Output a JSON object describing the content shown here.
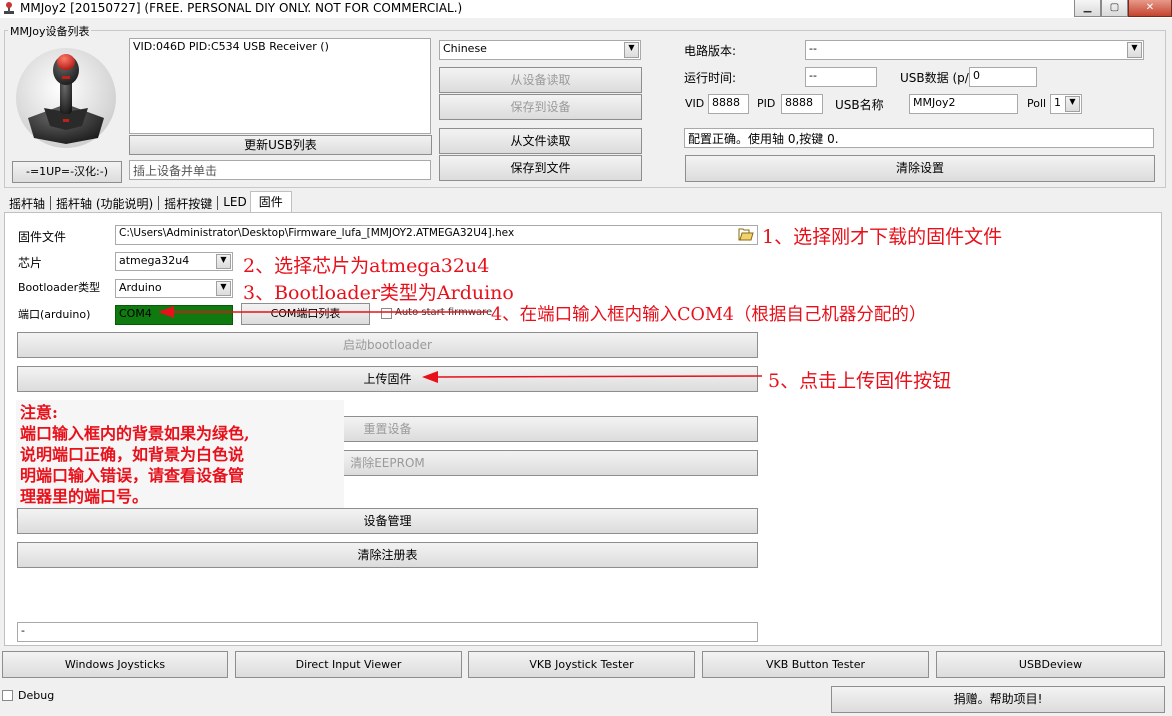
{
  "window": {
    "title": "MMJoy2 [20150727] (FREE. PERSONAL DIY ONLY. NOT FOR COMMERCIAL.)"
  },
  "device_group": {
    "label": "MMJoy设备列表",
    "device_list": [
      "VID:046D PID:C534 USB Receiver ()"
    ],
    "refresh_usb_label": "更新USB列表",
    "about_label": "-=1UP=-汉化:-)",
    "hint_text": "插上设备并单击"
  },
  "language": {
    "selected": "Chinese"
  },
  "actions": {
    "read_device": "从设备读取",
    "save_device": "保存到设备",
    "read_file": "从文件读取",
    "save_file": "保存到文件"
  },
  "board": {
    "version_label": "电路版本:",
    "version_value": "--",
    "uptime_label": "运行时间:",
    "uptime_value": "--",
    "usb_data_label": "USB数据 (p/s",
    "usb_data_value": "0",
    "vid_label": "VID",
    "vid_value": "8888",
    "pid_label": "PID",
    "pid_value": "8888",
    "usb_name_label": "USB名称",
    "usb_name_value": "MMJoy2",
    "poll_label": "Poll",
    "poll_value": "1",
    "status_text": "配置正确。使用轴 0,按键 0.",
    "clear_settings": "清除设置"
  },
  "tabs": [
    "摇杆轴",
    "摇杆轴 (功能说明)",
    "摇杆按键",
    "LED",
    "固件"
  ],
  "firmware": {
    "file_label": "固件文件",
    "file_path": "C:\\Users\\Administrator\\Desktop\\Firmware_lufa_[MMJOY2.ATMEGA32U4].hex",
    "chip_label": "芯片",
    "chip_value": "atmega32u4",
    "bootloader_label": "Bootloader类型",
    "bootloader_value": "Arduino",
    "port_label": "端口(arduino)",
    "port_value": "COM4",
    "com_list_button": "COM端口列表",
    "auto_start_label": "Auto start firmware",
    "start_bootloader": "启动bootloader",
    "upload_firmware": "上传固件",
    "reset_device": "重置设备",
    "clear_eeprom": "清除EEPROM",
    "device_manager": "设备管理",
    "clear_registry": "清除注册表",
    "log_text": "-"
  },
  "annotations": {
    "step1": "1、选择刚才下载的固件文件",
    "step2": "2、选择芯片为atmega32u4",
    "step3": "3、Bootloader类型为Arduino",
    "step4": "4、在端口输入框内输入COM4（根据自己机器分配的）",
    "step5": "5、点击上传固件按钮",
    "note_title": "注意:",
    "note_line1": "端口输入框内的背景如果为绿色,",
    "note_line2": "说明端口正确，如背景为白色说",
    "note_line3": "明端口输入错误，请查看设备管",
    "note_line4": "理器里的端口号。",
    "color": "#e8101a"
  },
  "tools": {
    "windows_joysticks": "Windows Joysticks",
    "direct_input_viewer": "Direct Input Viewer",
    "vkb_joystick_tester": "VKB Joystick Tester",
    "vkb_button_tester": "VKB Button Tester",
    "usbdeview": "USBDeview"
  },
  "footer": {
    "debug_label": "Debug",
    "donate_label": "捐赠。帮助项目!"
  }
}
